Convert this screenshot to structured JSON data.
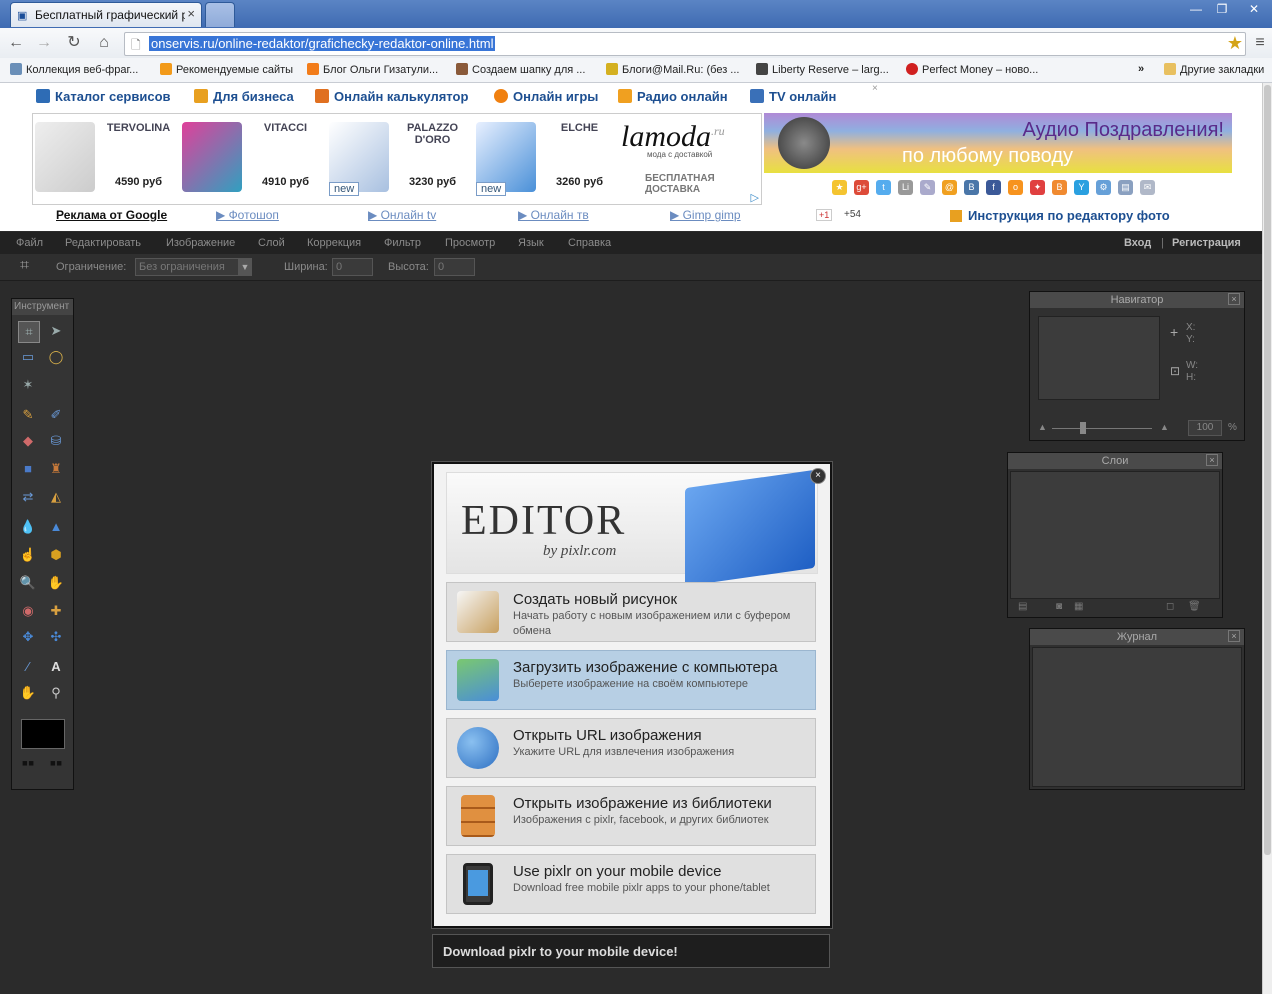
{
  "browser": {
    "tab_title": "Бесплатный графический р",
    "url": "onservis.ru/online-redaktor/grafichecky-redaktor-online.html",
    "bookmarks": [
      {
        "label": "Коллекция веб-фраг...",
        "color": "#6a8fb8"
      },
      {
        "label": "Рекомендуемые сайты",
        "color": "#f29a1a"
      },
      {
        "label": "Блог Ольги Гизатули...",
        "color": "#f27c1a"
      },
      {
        "label": "Создаем шапку для ...",
        "color": "#8a5a3a"
      },
      {
        "label": "Блоги@Mail.Ru: (без ...",
        "color": "#d4b020"
      },
      {
        "label": "Liberty Reserve – larg...",
        "color": "#444444"
      },
      {
        "label": "Perfect Money – ново...",
        "color": "#d02020"
      }
    ],
    "bookmarks_more": "»",
    "other_bookmarks": "Другие закладки"
  },
  "site": {
    "nav": [
      {
        "label": "Каталог сервисов",
        "color": "#2e6cb5"
      },
      {
        "label": "Для бизнеса",
        "color": "#e8a020"
      },
      {
        "label": "Онлайн калькулятор",
        "color": "#e07020"
      },
      {
        "label": "Онлайн игры",
        "color": "#f08010"
      },
      {
        "label": "Радио онлайн",
        "color": "#f0a020"
      },
      {
        "label": "TV онлайн",
        "color": "#3a70b8"
      }
    ],
    "nav_close": "×",
    "shoes": [
      {
        "brand": "TERVOLINA",
        "price": "4590 руб",
        "new": ""
      },
      {
        "brand": "VITACCI",
        "price": "4910 руб",
        "new": ""
      },
      {
        "brand": "PALAZZO D'ORO",
        "price": "3230 руб",
        "new": "new"
      },
      {
        "brand": "ELCHE",
        "price": "3260 руб",
        "new": "new"
      }
    ],
    "lamoda_logo": "lamoda",
    "lamoda_tld": ".ru",
    "lamoda_sub": "мода с доставкой",
    "lamoda_delivery": "БЕСПЛАТНАЯ ДОСТАВКА",
    "adchoices": "▷",
    "banner_line1": "Аудио Поздравления!",
    "banner_line2": "по любому поводу",
    "sublinks": [
      {
        "label": "Реклама от Google"
      },
      {
        "label": "▶ Фотошоп"
      },
      {
        "label": "▶ Онлайн tv"
      },
      {
        "label": "▶ Онлайн тв"
      },
      {
        "label": "▶ Gimp gimp"
      }
    ],
    "gplus": "+1",
    "gplus_count": "+54",
    "instruction": "Инструкция по редактору фото"
  },
  "editor": {
    "menu": [
      "Файл",
      "Редактировать",
      "Изображение",
      "Слой",
      "Коррекция",
      "Фильтр",
      "Просмотр",
      "Язык",
      "Справка"
    ],
    "login": "Вход",
    "sep": "|",
    "register": "Регистрация",
    "options": {
      "constraint_label": "Ограничение:",
      "constraint_value": "Без ограничения",
      "width_label": "Ширина:",
      "width_value": "0",
      "height_label": "Высота:",
      "height_value": "0"
    },
    "tools_title": "Инструмент",
    "navigator": {
      "title": "Навигатор",
      "x": "X:",
      "y": "Y:",
      "w": "W:",
      "h": "H:",
      "zoom": "100",
      "pct": "%"
    },
    "layers": {
      "title": "Слои"
    },
    "history": {
      "title": "Журнал"
    },
    "panel_close": "×"
  },
  "dialog": {
    "logo_word": "EDITOR",
    "logo_by": "by pixlr.com",
    "close": "×",
    "options": [
      {
        "title": "Создать новый рисунок",
        "desc": "Начать работу с новым изображением или с буфером обмена",
        "icon": "brush-icon",
        "color": "#c8a060"
      },
      {
        "title": "Загрузить изображение с компьютера",
        "desc": "Выберете изображение на своём компьютере",
        "icon": "folder-upload-icon",
        "color": "#4a8ed8"
      },
      {
        "title": "Открыть URL изображения",
        "desc": "Укажите URL для извлечения изображения",
        "icon": "globe-icon",
        "color": "#2d6fc2"
      },
      {
        "title": "Открыть изображение из библиотеки",
        "desc": "Изображения с pixlr, facebook, и других библиотек",
        "icon": "cabinet-icon",
        "color": "#d07a2a"
      },
      {
        "title": "Use pixlr on your mobile device",
        "desc": "Download free mobile pixlr apps to your phone/tablet",
        "icon": "mobile-icon",
        "color": "#3a3a3a"
      }
    ],
    "download_bar": "Download pixlr to your mobile device!"
  }
}
